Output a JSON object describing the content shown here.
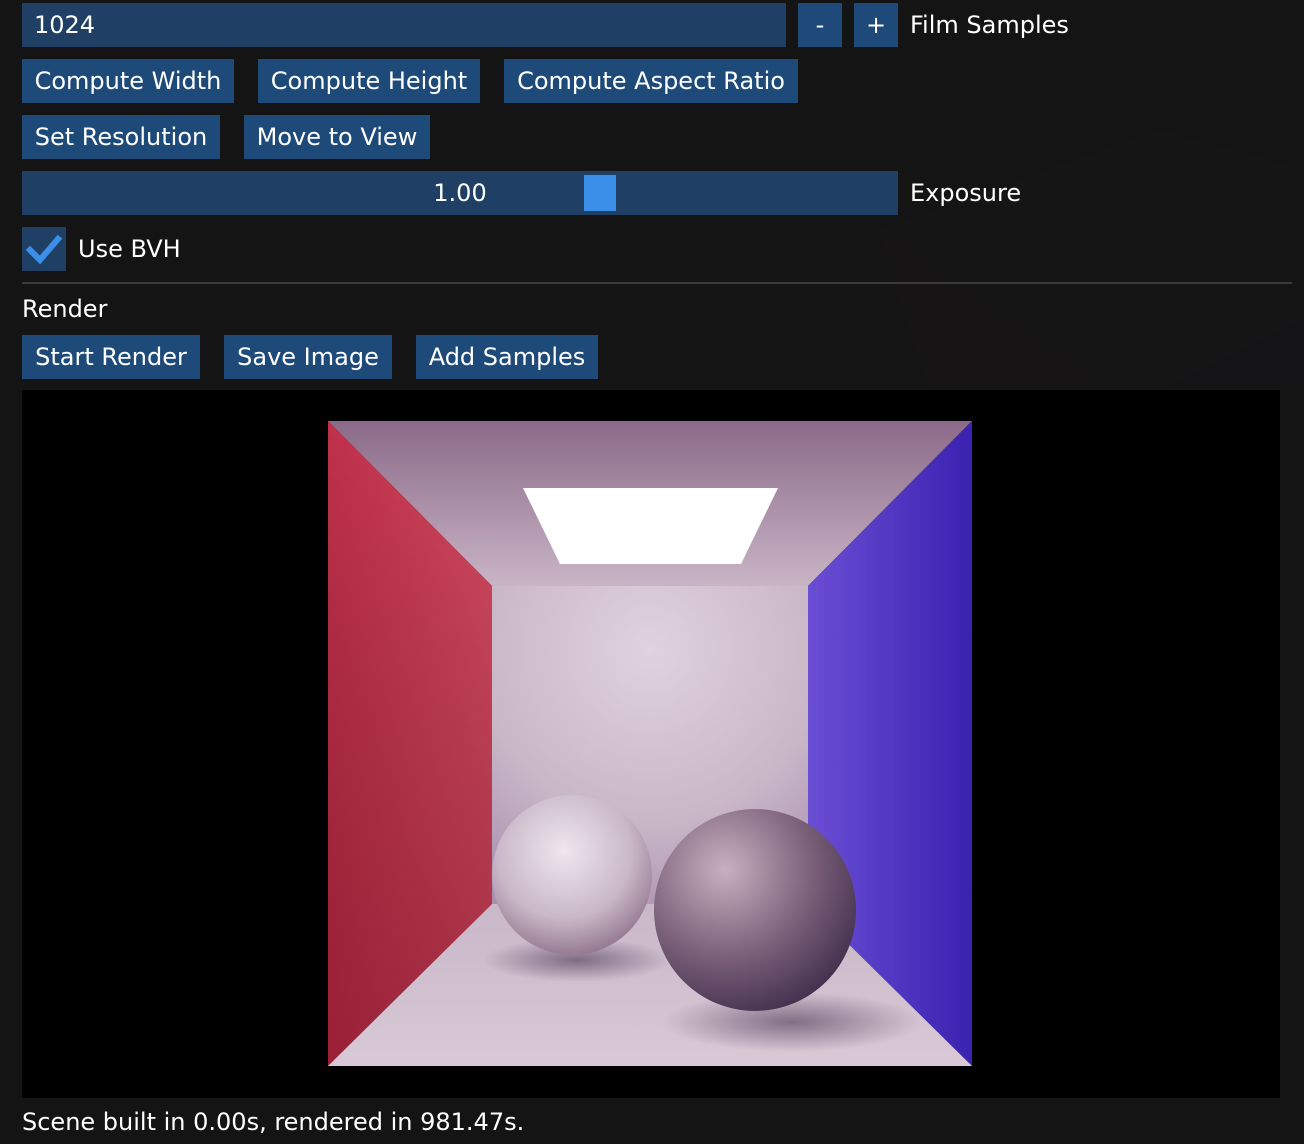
{
  "film_samples": {
    "value": "1024",
    "decrement_label": "-",
    "increment_label": "+",
    "label": "Film Samples"
  },
  "compute_buttons": {
    "width": "Compute Width",
    "height": "Compute Height",
    "aspect": "Compute Aspect Ratio"
  },
  "view_buttons": {
    "set_resolution": "Set Resolution",
    "move_to_view": "Move to View"
  },
  "exposure": {
    "value_text": "1.00",
    "label": "Exposure",
    "level": 0.666
  },
  "bvh": {
    "label": "Use BVH",
    "checked": true
  },
  "render_section": {
    "header": "Render",
    "start": "Start Render",
    "save": "Save Image",
    "add": "Add Samples"
  },
  "status_text": "Scene built in 0.00s, rendered in 981.47s.",
  "colors": {
    "frame_bg": "#1f4064",
    "button_bg": "#1e4a7a",
    "accent": "#3c8fe8",
    "text": "#ffffff",
    "red_wall": "#c8283c",
    "blue_wall": "#4a30c8"
  }
}
